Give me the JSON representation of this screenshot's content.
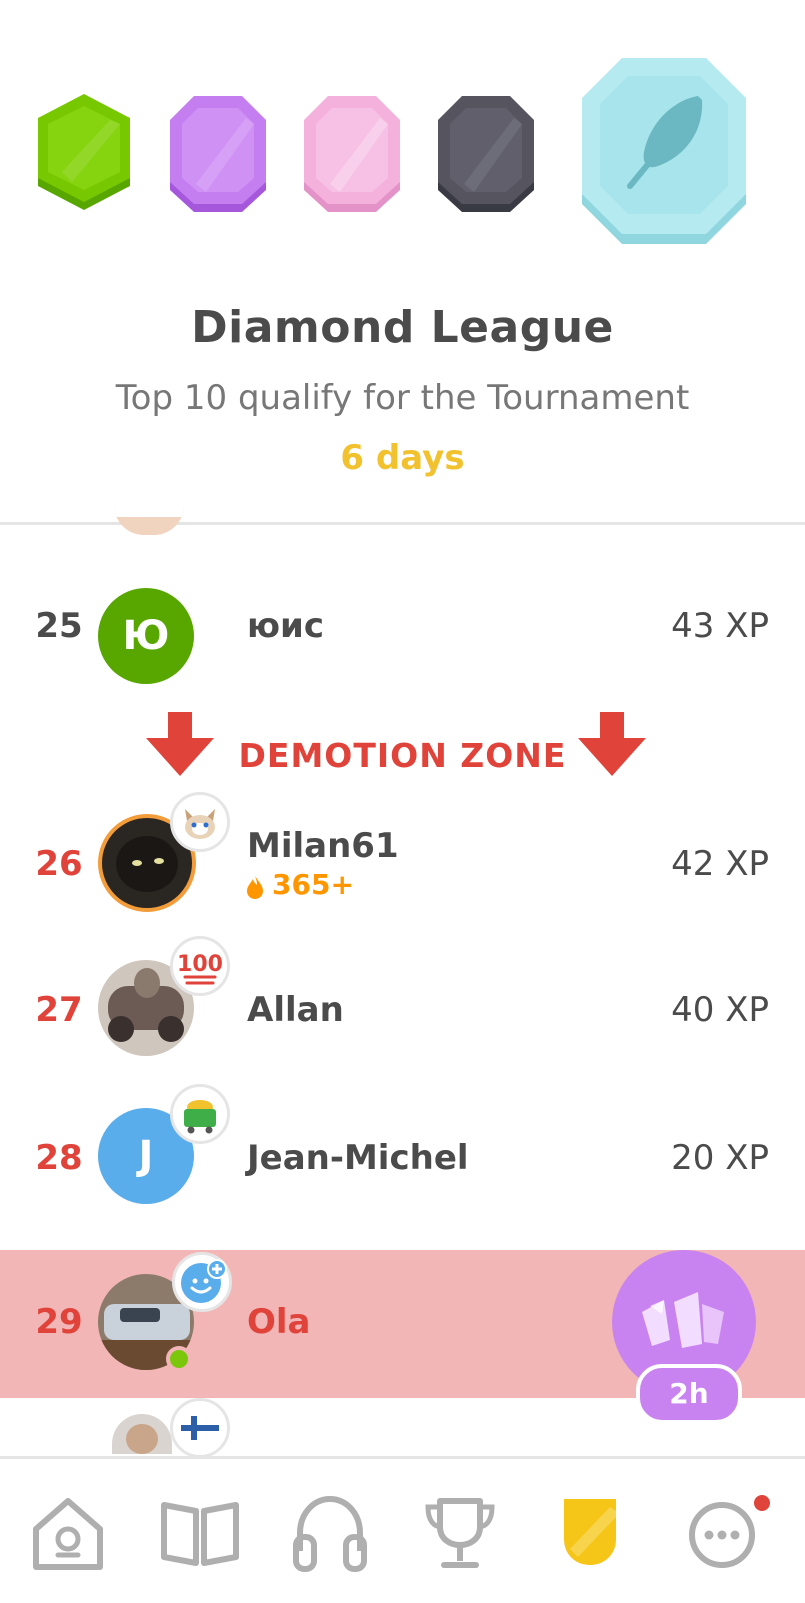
{
  "league": {
    "title": "Diamond League",
    "subtitle": "Top 10 qualify for the Tournament",
    "time_left": "6 days",
    "badges": [
      "bronze-green-badge",
      "amethyst-badge",
      "pearl-badge",
      "obsidian-badge",
      "diamond-badge"
    ]
  },
  "demotion": {
    "label": "DEMOTION ZONE"
  },
  "leaderboard": [
    {
      "rank": "25",
      "name": "юис",
      "xp": "43 XP",
      "avatar_letter": "Ю"
    },
    {
      "rank": "26",
      "name": "Milan61",
      "xp": "42 XP",
      "streak": "365+"
    },
    {
      "rank": "27",
      "name": "Allan",
      "xp": "40 XP",
      "emoji_badge": "100"
    },
    {
      "rank": "28",
      "name": "Jean-Michel",
      "xp": "20 XP",
      "avatar_letter": "J"
    },
    {
      "rank": "29",
      "name": "Ola",
      "xp": "",
      "highlighted": true
    }
  ],
  "chest": {
    "timer": "2h"
  },
  "nav": {
    "items": [
      "home-icon",
      "book-icon",
      "headphones-icon",
      "trophy-icon",
      "shield-icon",
      "more-icon"
    ],
    "active": "shield-icon"
  },
  "colors": {
    "accent_gold": "#f2c12e",
    "demotion_red": "#e0433a",
    "highlight_row": "#f3b6b6",
    "chest_purple": "#c883f0"
  }
}
